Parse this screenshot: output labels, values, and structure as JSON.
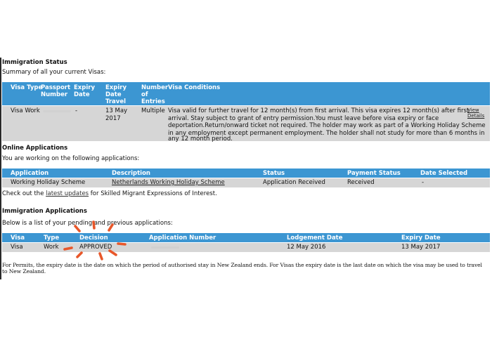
{
  "immigration_status": {
    "title": "Immigration Status",
    "summary": "Summary of all your current Visas:",
    "headers": {
      "visa_type": "Visa Type",
      "passport_number": "Passport Number",
      "expiry_date": "Expiry Date",
      "expiry_date_travel": "Expiry Date Travel",
      "number_of_entries": "Number of Entries",
      "visa_conditions": "Visa Conditions"
    },
    "row": {
      "visa_type": "Visa  Work",
      "expiry_date": "-",
      "expiry_date_travel_1": "13 May",
      "expiry_date_travel_2": "2017",
      "number_of_entries": "Multiple",
      "conditions": [
        "Visa valid for further travel for 12 month(s) from first arrival. This visa expires 12 month(s) after first",
        "arrival. Stay subject to grant of entry permission.You must leave before visa expiry or face",
        "deportation.Return/onward ticket not required. The holder may work as part of a Working Holiday Scheme",
        "in any employment except permanent employment. The holder shall not study for more than 6 months in",
        "any 12 month period."
      ],
      "view_link": "View",
      "details_link": "Details"
    }
  },
  "online_applications": {
    "title": "Online Applications",
    "summary": "You are working on the following applications:",
    "headers": {
      "application": "Application",
      "description": "Description",
      "status": "Status",
      "payment_status": "Payment Status",
      "date_selected": "Date Selected"
    },
    "row": {
      "application": "Working Holiday Scheme",
      "description": "Netherlands Working Holiday Scheme",
      "status": "Application Received",
      "payment_status": "Received",
      "date_selected": "-"
    },
    "note_prefix": "Check out the ",
    "note_link": "latest updates",
    "note_suffix": " for Skilled Migrant Expressions of Interest."
  },
  "immigration_applications": {
    "title": "Immigration Applications",
    "summary": "Below is a list of your pending and previous applications:",
    "headers": {
      "visa": "Visa",
      "type": "Type",
      "decision": "Decision",
      "application_number": "Application Number",
      "lodgement_date": "Lodgement Date",
      "expiry_date": "Expiry Date"
    },
    "row": {
      "visa": "Visa",
      "type": "Work",
      "decision": "APPROVED",
      "lodgement_date": "12 May 2016",
      "expiry_date": "13 May 2017"
    }
  },
  "footer_note": "For Permits, the expiry date is the date on which the period of authorised stay in New Zealand ends. For Visas the expiry date is the last date on which the visa may be used to travel to New Zealand.",
  "colors": {
    "header_bg": "#3c96d2",
    "row_bg": "#d6d6d6",
    "highlight": "#e8572a"
  }
}
